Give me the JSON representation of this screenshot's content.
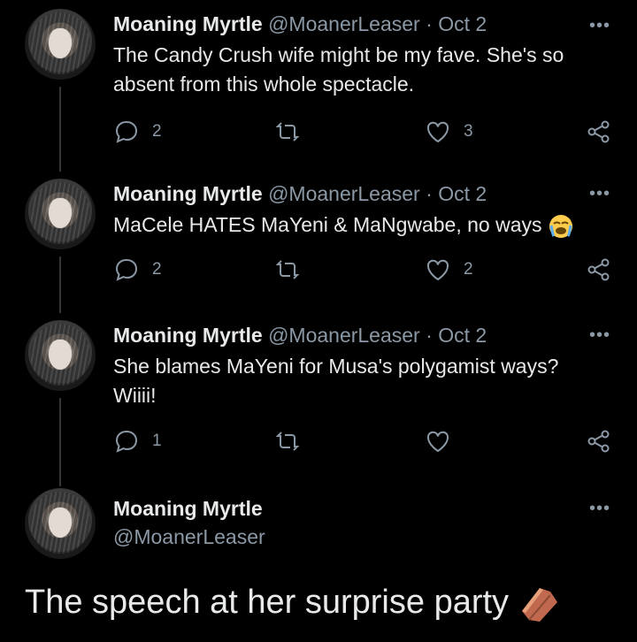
{
  "tweets": [
    {
      "name": "Moaning Myrtle",
      "handle": "@MoanerLeaser",
      "date": "Oct 2",
      "text_line1": "The Candy Crush wife might be my fave. She's so",
      "text_line2": "absent from this whole spectacle.",
      "reply_count": "2",
      "retweet_count": "",
      "like_count": "3"
    },
    {
      "name": "Moaning Myrtle",
      "handle": "@MoanerLeaser",
      "date": "Oct 2",
      "text_line1": "MaCele HATES MaYeni & MaNgwabe, no ways",
      "emoji": "loudly-crying-face",
      "reply_count": "2",
      "retweet_count": "",
      "like_count": "2"
    },
    {
      "name": "Moaning Myrtle",
      "handle": "@MoanerLeaser",
      "date": "Oct 2",
      "text_line1": "She blames MaYeni for Musa's polygamist ways?",
      "text_line2": "Wiiii!",
      "reply_count": "1",
      "retweet_count": "",
      "like_count": ""
    }
  ],
  "main_tweet": {
    "name": "Moaning Myrtle",
    "handle": "@MoanerLeaser",
    "text": "The speech at her surprise party",
    "emoji": "coffin"
  },
  "separator": "·",
  "more_label": "•••",
  "colors": {
    "background": "#000000",
    "text": "#e7e9ea",
    "muted": "#8b98a5",
    "thread_line": "#333639"
  }
}
